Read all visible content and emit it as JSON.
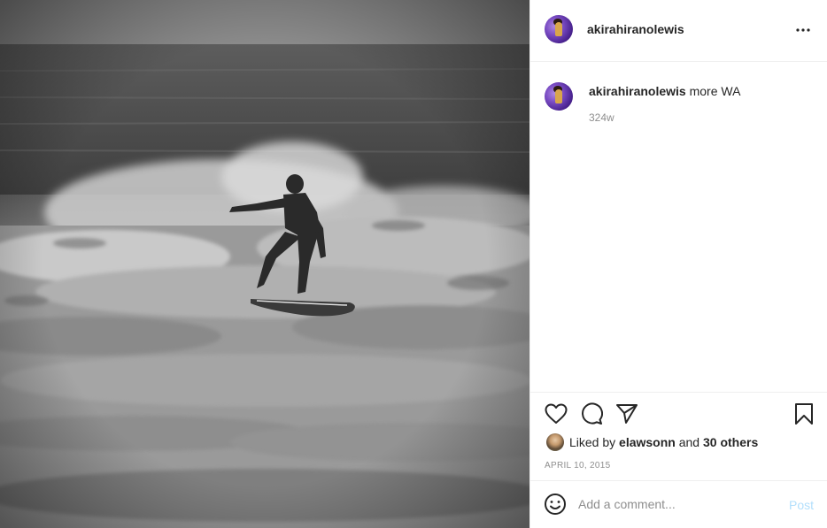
{
  "post": {
    "image_alt": "",
    "author": "akirahiranolewis",
    "caption_text": " more WA",
    "caption_age": "324w",
    "liked_by_prefix": "Liked by ",
    "liked_by_user": "elawsonn",
    "liked_by_mid": " and ",
    "liked_by_others": "30 others",
    "date": "APRIL 10, 2015"
  },
  "comment": {
    "placeholder": "Add a comment...",
    "post_label": "Post"
  },
  "colors": {
    "border": "#efefef",
    "text": "#262626",
    "muted": "#8e8e8e",
    "post_disabled": "#b2dffc"
  },
  "icons": {
    "more": "more-options-icon",
    "like": "heart-icon",
    "comment": "comment-bubble-icon",
    "share": "paper-plane-icon",
    "save": "bookmark-icon",
    "emoji": "smiley-icon"
  }
}
